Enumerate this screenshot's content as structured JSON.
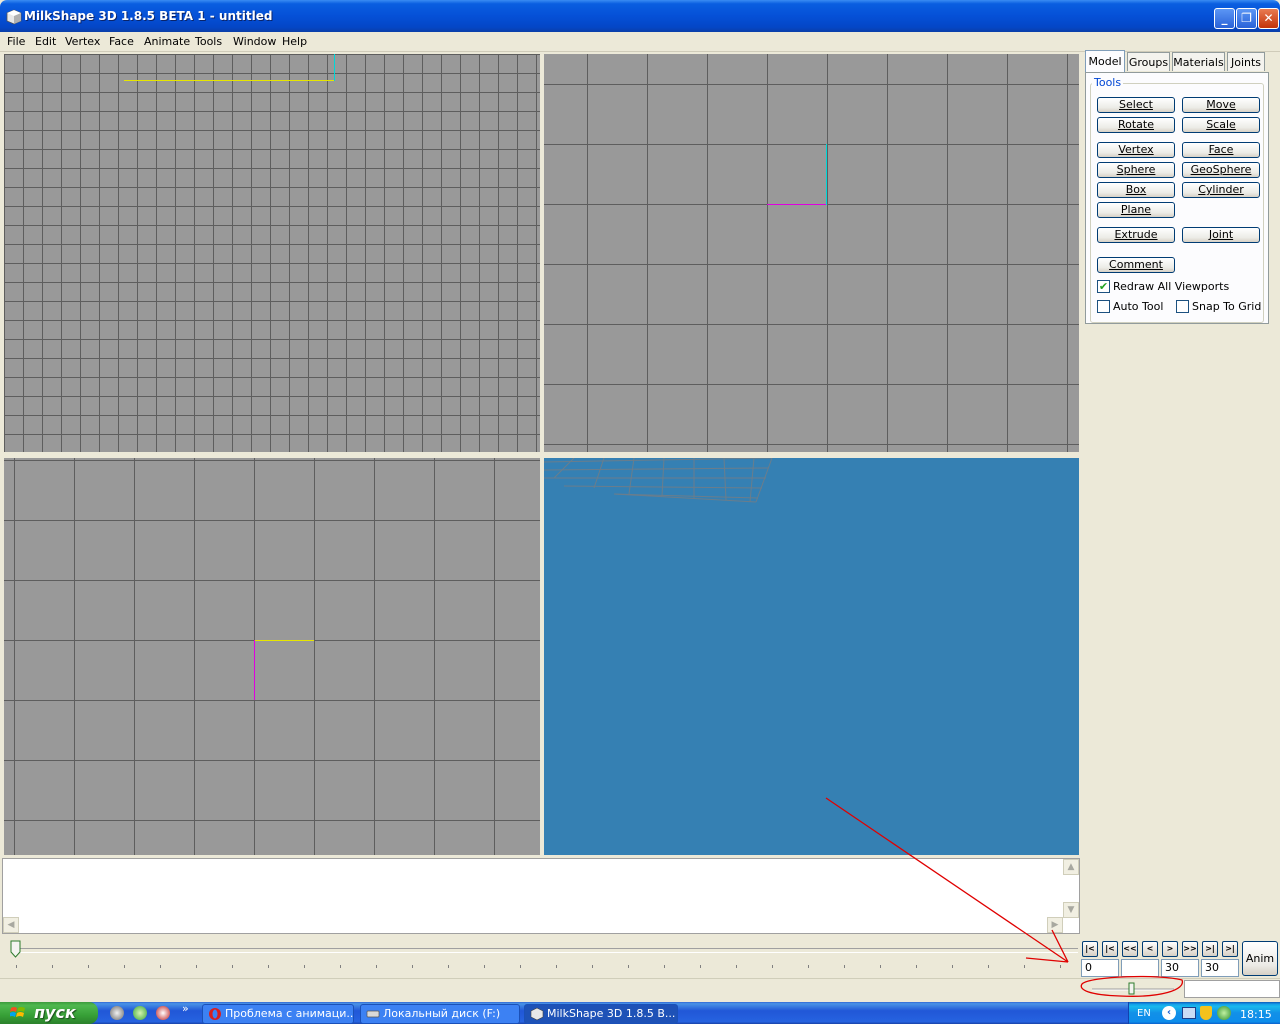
{
  "window": {
    "title": "MilkShape 3D 1.8.5 BETA 1 - untitled",
    "minimize": "_",
    "maximize": "❐",
    "close": "✕"
  },
  "menu": [
    "File",
    "Edit",
    "Vertex",
    "Face",
    "Animate",
    "Tools",
    "Window",
    "Help"
  ],
  "panel": {
    "tabs": [
      "Model",
      "Groups",
      "Materials",
      "Joints"
    ],
    "active_tab": "Model",
    "tools_legend": "Tools",
    "buttons": {
      "select": "Select",
      "move": "Move",
      "rotate": "Rotate",
      "scale": "Scale",
      "vertex": "Vertex",
      "face": "Face",
      "sphere": "Sphere",
      "geosphere": "GeoSphere",
      "box": "Box",
      "cylinder": "Cylinder",
      "plane": "Plane",
      "extrude": "Extrude",
      "joint": "Joint",
      "comment": "Comment"
    },
    "checkboxes": {
      "redraw_all_viewports": {
        "label": "Redraw All Viewports",
        "checked": true
      },
      "auto_tool": {
        "label": "Auto Tool",
        "checked": false
      },
      "snap_to_grid": {
        "label": "Snap To Grid",
        "checked": false
      }
    }
  },
  "anim": {
    "nav_buttons": [
      "|<",
      "|<",
      "<<",
      "<",
      ">",
      ">>",
      ">|",
      ">|"
    ],
    "current_frame": "0",
    "frame_blank": "",
    "frame_a": "30",
    "frame_b": "30",
    "anim_button": "Anim"
  },
  "taskbar": {
    "start_label": "пуск",
    "overflow": "»",
    "tasks": [
      {
        "label": "Проблема с анимаци...",
        "active": false
      },
      {
        "label": "Локальный диск (F:)",
        "active": false
      },
      {
        "label": "MilkShape 3D 1.8.5 B...",
        "active": true
      }
    ],
    "language": "EN",
    "clock": "18:15"
  },
  "colors": {
    "viewport_gray": "#999999",
    "viewport_3d_blue": "#3580b3",
    "axis_yellow": "#e6e600",
    "axis_cyan": "#00d8d8",
    "axis_magenta": "#e000e0",
    "annotation_red": "#e00000"
  }
}
